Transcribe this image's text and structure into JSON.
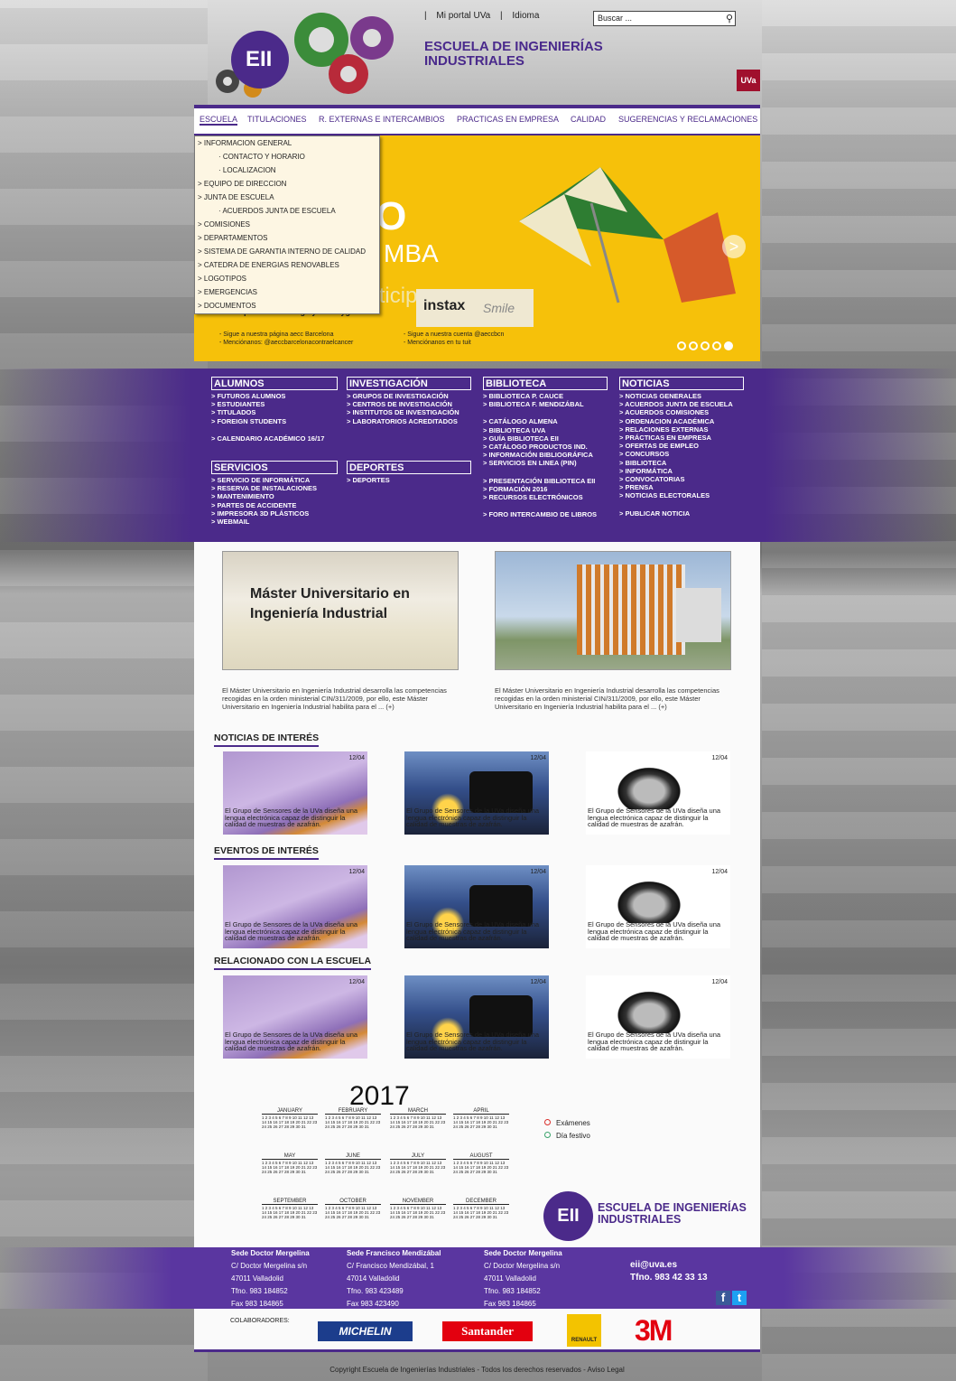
{
  "header": {
    "portal": "Mi portal UVa",
    "language": "Idioma",
    "search_placeholder": "Buscar ...",
    "logo_text": "EII",
    "title_line1": "ESCUELA DE INGENIERÍAS",
    "title_line2": "INDUSTRIALES",
    "uva_badge": "UVa"
  },
  "nav": {
    "items": [
      "ESCUELA",
      "TITULACIONES",
      "R. EXTERNAS E INTERCAMBIOS",
      "PRACTICAS EN EMPRESA",
      "CALIDAD",
      "SUGERENCIAS Y RECLAMACIONES"
    ]
  },
  "dropdown": {
    "items": [
      "> INFORMACION GENERAL",
      "· CONTACTO Y HORARIO",
      "· LOCALIZACION",
      "> EQUIPO DE DIRECCION",
      "> JUNTA DE ESCUELA",
      "· ACUERDOS JUNTA DE ESCUELA",
      "> COMISIONES",
      "> DEPARTAMENTOS",
      "> SISTEMA DE GARANTIA INTERNO DE CALIDAD",
      "> CATEDRA DE ENERGIAS RENOVABLES",
      "> LOGOTIPOS",
      "> EMERGENCIAS",
      "> DOCUMENTOS"
    ]
  },
  "slider": {
    "big": "RSO",
    "mba": "MBA",
    "participate": "participar",
    "instax": "instax",
    "smile": "Smile",
    "hashtag": "2.- Esqueta el hashtag #yonosoygamba.",
    "fb_line1": "- Sigue a nuestra página aecc Barcelona",
    "fb_line2": "- Menciónanos: @aeccbarcelonacontraelcancer",
    "tw_line1": "- Sigue a nuestra cuenta @aeccbcn",
    "tw_line2": "- Menciónanos en tu tuit",
    "arrow": ">"
  },
  "columns": {
    "alumnos": {
      "title": "ALUMNOS",
      "items": [
        "> FUTUROS ALUMNOS",
        "> ESTUDIANTES",
        "> TITULADOS",
        "> FOREIGN STUDENTS"
      ],
      "extra": "> CALENDARIO ACADÉMICO 16/17"
    },
    "investigacion": {
      "title": "INVESTIGACIÓN",
      "items": [
        "> GRUPOS DE INVESTIGACIÓN",
        "> CENTROS DE INVESTIGACIÓN",
        "> INSTITUTOS DE INVESTIGACIÓN",
        "> LABORATORIOS ACREDITADOS"
      ]
    },
    "biblioteca": {
      "title": "BIBLIOTECA",
      "items1": [
        "> BIBLIOTECA P. CAUCE",
        "> BIBLIOTECA F. MENDIZÁBAL"
      ],
      "items2": [
        "> CATÁLOGO ALMENA",
        "> BIBLIOTECA UVA",
        "> GUÍA BIBLIOTECA EII",
        "> CATÁLOGO PRODUCTOS IND.",
        "> INFORMACIÓN BIBLIOGRÁFICA",
        "> SERVICIOS EN LINEA (PIN)"
      ],
      "items3": [
        "> PRESENTACIÓN BIBLIOTECA EII",
        "> FORMACIÓN 2016",
        "> RECURSOS ELECTRÓNICOS"
      ],
      "items4": [
        "> FORO INTERCAMBIO DE LIBROS"
      ]
    },
    "noticias": {
      "title": "NOTICIAS",
      "items": [
        "> NOTICIAS GENERALES",
        "> ACUERDOS JUNTA DE ESCUELA",
        "> ACUERDOS COMISIONES",
        "> ORDENACION ACADÉMICA",
        "> RELACIONES EXTERNAS",
        "> PRÁCTICAS EN EMPRESA",
        "> OFERTAS DE EMPLEO",
        "> CONCURSOS",
        "> BIBLIOTECA",
        "> INFORMÁTICA",
        "> CONVOCATORIAS",
        "> PRENSA",
        "> NOTICIAS ELECTORALES"
      ],
      "extra": "> PUBLICAR NOTICIA"
    },
    "servicios": {
      "title": "SERVICIOS",
      "items": [
        "> SERVICIO DE INFORMÁTICA",
        "> RESERVA DE INSTALACIONES",
        "> MANTENIMIENTO",
        "> PARTES DE ACCIDENTE",
        "> IMPRESORA 3D PLÁSTICOS",
        "> WEBMAIL"
      ]
    },
    "deportes": {
      "title": "DEPORTES",
      "items": [
        "> DEPORTES"
      ]
    }
  },
  "featured": {
    "left_title": "Máster Universitario en Ingeniería Industrial",
    "desc": "El Máster Universitario en Ingeniería Industrial desarrolla las competencias recogidas en la orden ministerial CIN/311/2009, por ello, este Máster Universitario en Ingeniería Industrial habilita para el ... (+)"
  },
  "sections": [
    {
      "title": "NOTICIAS DE INTERÉS"
    },
    {
      "title": "EVENTOS DE INTERÉS"
    },
    {
      "title": "RELACIONADO CON LA ESCUELA"
    }
  ],
  "card": {
    "date": "12/04",
    "caption": "El Grupo de Sensores de la UVa diseña una lengua electrónica capaz de distinguir la calidad de muestras de azafrán."
  },
  "calendar": {
    "year": "2017",
    "months": [
      "JANUARY",
      "FEBRUARY",
      "MARCH",
      "APRIL",
      "MAY",
      "JUNE",
      "JULY",
      "AUGUST",
      "SEPTEMBER",
      "OCTOBER",
      "NOVEMBER",
      "DECEMBER"
    ],
    "legend": [
      {
        "label": "Exámenes",
        "color": "#d9302c"
      },
      {
        "label": "Día festivo",
        "color": "#3aa36b"
      }
    ],
    "logo_line1": "ESCUELA DE INGENIERÍAS",
    "logo_line2": "INDUSTRIALES"
  },
  "footer": {
    "sedes": [
      {
        "name": "Sede Doctor Mergelina",
        "addr": "C/ Doctor Mergelina s/n",
        "city": "47011 Valladolid",
        "tel": "Tfno. 983 184852",
        "fax": "Fax 983 184865"
      },
      {
        "name": "Sede Francisco Mendizábal",
        "addr": "C/ Francisco Mendizábal, 1",
        "city": "47014 Valladolid",
        "tel": "Tfno. 983 423489",
        "fax": "Fax 983 423490"
      },
      {
        "name": "Sede Doctor Mergelina",
        "addr": "C/ Doctor Mergelina s/n",
        "city": "47011 Valladolid",
        "tel": "Tfno. 983 184852",
        "fax": "Fax 983 184865"
      }
    ],
    "email": "eii@uva.es",
    "phone": "Tfno. 983 42 33 13",
    "collab_label": "COLABORADORES:",
    "sponsors": [
      "MICHELIN",
      "Santander",
      "RENAULT",
      "3M"
    ],
    "copyright": "Copyright Escuela de Ingenierías Industriales - Todos los derechos reservados - Aviso Legal"
  }
}
